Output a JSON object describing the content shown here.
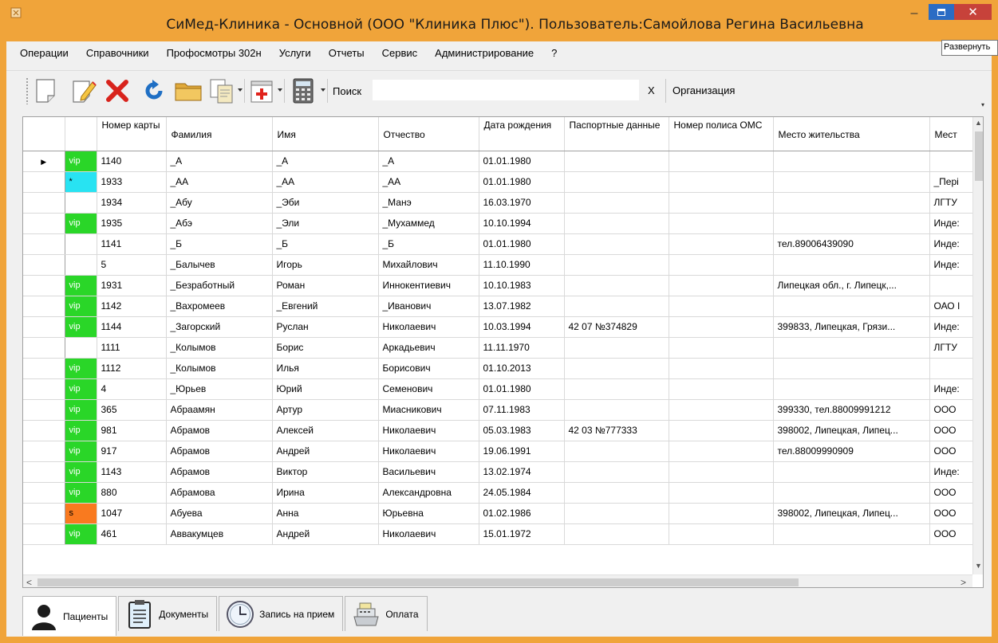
{
  "window": {
    "title": "СиМед-Клиника - Основной (ООО \"Клиника Плюс\"). Пользователь:Самойлова Регина Васильевна",
    "tooltip": "Развернуть",
    "min_glyph": "–",
    "close_glyph": "✕"
  },
  "menu": [
    "Операции",
    "Справочники",
    "Профосмотры 302н",
    "Услуги",
    "Отчеты",
    "Сервис",
    "Администрирование",
    "?"
  ],
  "toolbar": {
    "search_label": "Поиск",
    "search_value": "",
    "search_clear": "X",
    "org_label": "Организация",
    "overflow_glyph": "▾"
  },
  "grid": {
    "columns": [
      "",
      "Номер карты",
      "Фамилия",
      "Имя",
      "Отчество",
      "Дата рождения",
      "Паспортные данные",
      "Номер полиса ОМС",
      "Место жительства",
      "Мест"
    ],
    "current_row_marker": "▶",
    "rows": [
      {
        "flag": "vip",
        "card": "1140",
        "last": "_А",
        "first": "_А",
        "middle": "_А",
        "dob": "01.01.1980",
        "passport": "",
        "oms": "",
        "address": "",
        "work": ""
      },
      {
        "flag": "*",
        "card": "1933",
        "last": "_АА",
        "first": "_АА",
        "middle": "_АА",
        "dob": "01.01.1980",
        "passport": "",
        "oms": "",
        "address": "",
        "work": "_Пері"
      },
      {
        "flag": "",
        "card": "1934",
        "last": "_Абу",
        "first": "_Эби",
        "middle": "_Манэ",
        "dob": "16.03.1970",
        "passport": "",
        "oms": "",
        "address": "",
        "work": "ЛГТУ"
      },
      {
        "flag": "vip",
        "card": "1935",
        "last": "_Абэ",
        "first": "_Эли",
        "middle": "_Мухаммед",
        "dob": "10.10.1994",
        "passport": "",
        "oms": "",
        "address": "",
        "work": "Инде:"
      },
      {
        "flag": "",
        "card": "1141",
        "last": "_Б",
        "first": "_Б",
        "middle": "_Б",
        "dob": "01.01.1980",
        "passport": "",
        "oms": "",
        "address": "тел.89006439090",
        "work": "Инде:"
      },
      {
        "flag": "",
        "card": "5",
        "last": "_Балычев",
        "first": "Игорь",
        "middle": "Михайлович",
        "dob": "11.10.1990",
        "passport": "",
        "oms": "",
        "address": "",
        "work": "Инде:"
      },
      {
        "flag": "vip",
        "card": "1931",
        "last": "_Безработный",
        "first": "Роман",
        "middle": "Иннокентиевич",
        "dob": "10.10.1983",
        "passport": "",
        "oms": "",
        "address": "Липецкая обл., г. Липецк,...",
        "work": ""
      },
      {
        "flag": "vip",
        "card": "1142",
        "last": "_Вахромеев",
        "first": "_Евгений",
        "middle": "_Иванович",
        "dob": "13.07.1982",
        "passport": "",
        "oms": "",
        "address": "",
        "work": "ОАО I"
      },
      {
        "flag": "vip",
        "card": "1144",
        "last": "_Загорский",
        "first": "Руслан",
        "middle": "Николаевич",
        "dob": "10.03.1994",
        "passport": "42 07 №374829",
        "oms": "",
        "address": "399833, Липецкая, Грязи...",
        "work": "Инде:"
      },
      {
        "flag": "",
        "card": "1111",
        "last": "_Колымов",
        "first": "Борис",
        "middle": "Аркадьевич",
        "dob": "11.11.1970",
        "passport": "",
        "oms": "",
        "address": "",
        "work": "ЛГТУ"
      },
      {
        "flag": "vip",
        "card": "1112",
        "last": "_Колымов",
        "first": "Илья",
        "middle": "Борисович",
        "dob": "01.10.2013",
        "passport": "",
        "oms": "",
        "address": "",
        "work": ""
      },
      {
        "flag": "vip",
        "card": "4",
        "last": "_Юрьев",
        "first": "Юрий",
        "middle": "Семенович",
        "dob": "01.01.1980",
        "passport": "",
        "oms": "",
        "address": "",
        "work": "Инде:"
      },
      {
        "flag": "vip",
        "card": "365",
        "last": "Абраамян",
        "first": "Артур",
        "middle": "Миасникович",
        "dob": "07.11.1983",
        "passport": "",
        "oms": "",
        "address": "399330, тел.88009991212",
        "work": "ООО"
      },
      {
        "flag": "vip",
        "card": "981",
        "last": "Абрамов",
        "first": "Алексей",
        "middle": "Николаевич",
        "dob": "05.03.1983",
        "passport": "42 03 №777333",
        "oms": "",
        "address": "398002, Липецкая, Липец...",
        "work": "ООО"
      },
      {
        "flag": "vip",
        "card": "917",
        "last": "Абрамов",
        "first": "Андрей",
        "middle": "Николаевич",
        "dob": "19.06.1991",
        "passport": "",
        "oms": "",
        "address": "тел.88009990909",
        "work": "ООО"
      },
      {
        "flag": "vip",
        "card": "1143",
        "last": "Абрамов",
        "first": "Виктор",
        "middle": "Васильевич",
        "dob": "13.02.1974",
        "passport": "",
        "oms": "",
        "address": "",
        "work": "Инде:"
      },
      {
        "flag": "vip",
        "card": "880",
        "last": "Абрамова",
        "first": "Ирина",
        "middle": "Александровна",
        "dob": "24.05.1984",
        "passport": "",
        "oms": "",
        "address": "",
        "work": "ООО"
      },
      {
        "flag": "s",
        "card": "1047",
        "last": "Абуева",
        "first": "Анна",
        "middle": "Юрьевна",
        "dob": "01.02.1986",
        "passport": "",
        "oms": "",
        "address": "398002, Липецкая, Липец...",
        "work": "ООО"
      },
      {
        "flag": "vip",
        "card": "461",
        "last": "Аввакумцев",
        "first": "Андрей",
        "middle": "Николаевич",
        "dob": "15.01.1972",
        "passport": "",
        "oms": "",
        "address": "",
        "work": "ООО"
      }
    ]
  },
  "scroll": {
    "up": "▲",
    "down": "▼",
    "left": "<",
    "right": ">"
  },
  "tabs": [
    {
      "label": "Пациенты",
      "icon": "patient-icon",
      "active": true
    },
    {
      "label": "Документы",
      "icon": "clipboard-icon",
      "active": false
    },
    {
      "label": "Запись на прием",
      "icon": "clock-icon",
      "active": false
    },
    {
      "label": "Оплата",
      "icon": "cash-register-icon",
      "active": false
    }
  ],
  "colors": {
    "title_bar": "#f0a43a",
    "vip": "#2ad628",
    "star": "#28e3f2",
    "s_flag": "#f97a1f",
    "close": "#c7423a",
    "maximize": "#2b6cc4"
  }
}
